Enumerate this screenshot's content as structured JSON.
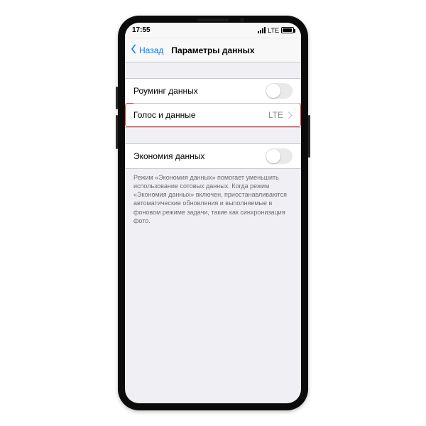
{
  "status": {
    "time": "17:55",
    "carrier": "LTE"
  },
  "nav": {
    "back": "Назад",
    "title": "Параметры данных"
  },
  "group1": {
    "roaming": {
      "label": "Роуминг данных"
    },
    "voice": {
      "label": "Голос и данные",
      "value": "LTE"
    }
  },
  "group2": {
    "lowdata": {
      "label": "Экономия данных"
    }
  },
  "footer": "Режим «Экономия данных» помогает уменьшить использование сотовых данных. Когда режим «Экономия данных» включен, приостанавливаются автоматические обновления и выполняемые в фоновом режиме задачи, такие как синхронизация фото."
}
